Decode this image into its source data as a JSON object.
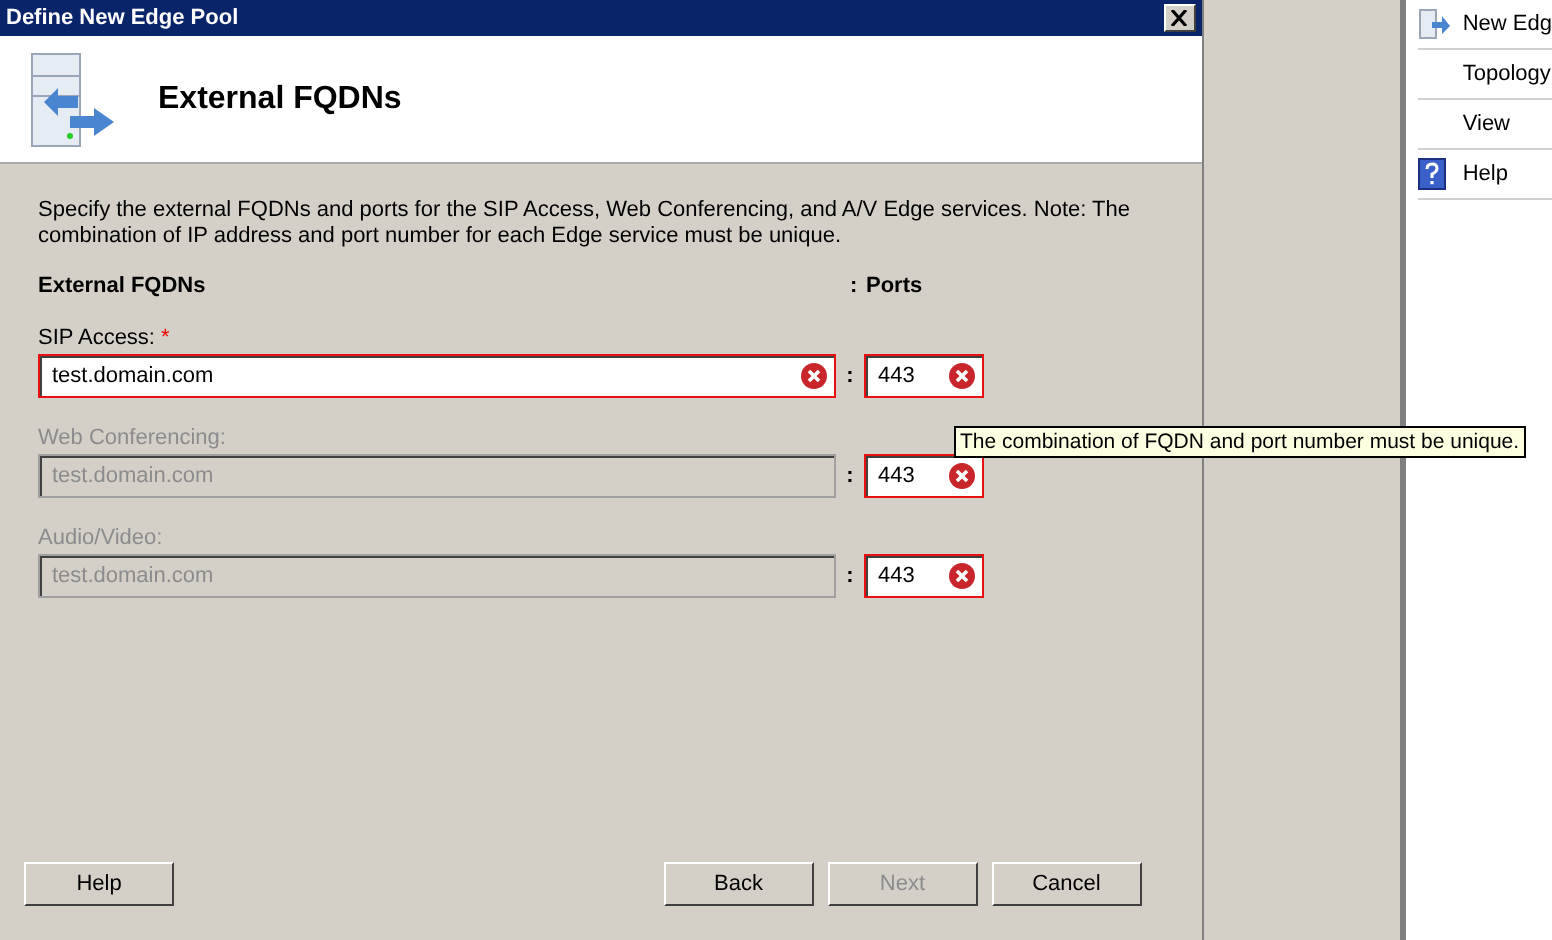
{
  "window": {
    "title": "Define New Edge Pool"
  },
  "header": {
    "title": "External FQDNs"
  },
  "description": "Specify the external FQDNs and ports for the SIP Access, Web Conferencing, and A/V Edge services. Note: The combination of IP address and port number for each Edge service must be unique.",
  "columns": {
    "fqdn": "External FQDNs",
    "separator": ":",
    "ports": "Ports"
  },
  "fields": [
    {
      "label": "SIP Access:",
      "required_mark": "*",
      "disabled": false,
      "fqdn": "test.domain.com",
      "fqdn_error": true,
      "separator": ":",
      "port": "443",
      "port_error": true
    },
    {
      "label": "Web Conferencing:",
      "disabled": true,
      "fqdn": "test.domain.com",
      "fqdn_error": false,
      "separator": ":",
      "port": "443",
      "port_error": true
    },
    {
      "label": "Audio/Video:",
      "disabled": true,
      "fqdn": "test.domain.com",
      "fqdn_error": false,
      "separator": ":",
      "port": "443",
      "port_error": true
    }
  ],
  "tooltip": "The combination of FQDN and port number must be unique.",
  "buttons": [
    {
      "label": "Help",
      "disabled": false
    },
    {
      "label": "Back",
      "disabled": false
    },
    {
      "label": "Next",
      "disabled": true
    },
    {
      "label": "Cancel",
      "disabled": false
    }
  ],
  "actions": [
    {
      "label": "New Edg",
      "kind": "wizard"
    },
    {
      "label": "Topology",
      "kind": "plain"
    },
    {
      "label": "View",
      "kind": "plain"
    },
    {
      "label": "Help",
      "kind": "help"
    }
  ]
}
